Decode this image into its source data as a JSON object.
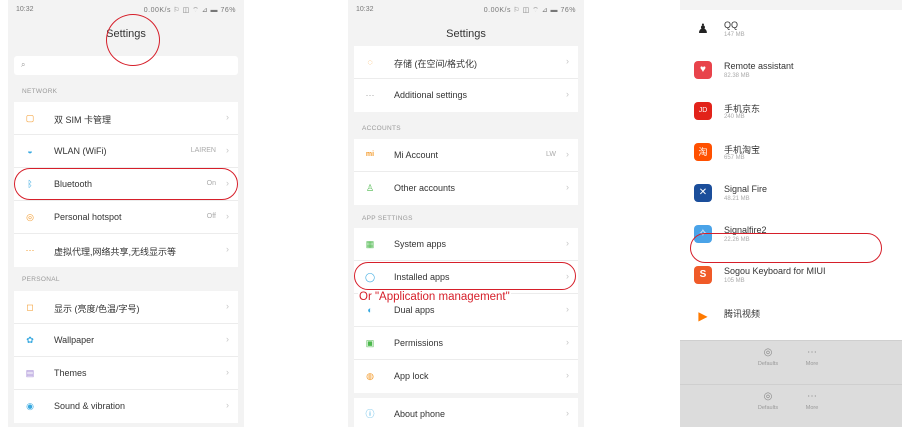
{
  "phone1": {
    "status": {
      "time": "10:32",
      "icons": "0.00K/s ⚐ ◫ ⌔ ⊿ ▬ 76%"
    },
    "title": "Settings",
    "search": {
      "placeholder": ""
    },
    "network_header": "NETWORK",
    "network_items": [
      {
        "icon": "sim-icon",
        "label": "双 SIM 卡管理",
        "value": ""
      },
      {
        "icon": "wifi-icon",
        "label": "WLAN (WiFi)",
        "value": "LAIREN"
      },
      {
        "icon": "bluetooth-icon",
        "label": "Bluetooth",
        "value": "On"
      },
      {
        "icon": "hotspot-icon",
        "label": "Personal hotspot",
        "value": "Off"
      },
      {
        "icon": "more-icon",
        "label": "虚拟代理,网络共享,无线显示等",
        "value": ""
      }
    ],
    "personal_header": "PERSONAL",
    "personal_items": [
      {
        "icon": "display-icon",
        "label": "显示 (亮度/色温/字号)",
        "value": ""
      },
      {
        "icon": "wallpaper-icon",
        "label": "Wallpaper",
        "value": ""
      },
      {
        "icon": "themes-icon",
        "label": "Themes",
        "value": ""
      },
      {
        "icon": "sound-icon",
        "label": "Sound & vibration",
        "value": ""
      }
    ]
  },
  "phone2": {
    "status": {
      "time": "10:32",
      "icons": "0.00K/s ⚐ ◫ ⌔ ⊿ ▬ 76%"
    },
    "title": "Settings",
    "top_items": [
      {
        "icon": "storage-icon",
        "label": "存储 (在空间/格式化)"
      },
      {
        "icon": "more-icon",
        "label": "Additional settings"
      }
    ],
    "accounts_header": "ACCOUNTS",
    "accounts_items": [
      {
        "icon": "mi-icon",
        "label": "Mi Account",
        "value": "LW"
      },
      {
        "icon": "person-icon",
        "label": "Other accounts",
        "value": ""
      }
    ],
    "app_settings_header": "APP SETTINGS",
    "app_items": [
      {
        "icon": "system-apps-icon",
        "label": "System apps"
      },
      {
        "icon": "installed-apps-icon",
        "label": "Installed apps"
      },
      {
        "icon": "dual-apps-icon",
        "label": "Dual apps"
      },
      {
        "icon": "permissions-icon",
        "label": "Permissions"
      },
      {
        "icon": "lock-icon",
        "label": "App lock"
      }
    ],
    "about_item": {
      "icon": "info-icon",
      "label": "About phone"
    },
    "annotation": "Or \"Application management\""
  },
  "phone3": {
    "apps": [
      {
        "name": "QQ",
        "size": "147 MB",
        "icon": "qq-icon",
        "color": "#ffffff"
      },
      {
        "name": "Remote assistant",
        "size": "82.38 MB",
        "icon": "remote-assistant-icon",
        "color": "#e8434b"
      },
      {
        "name": "手机京东",
        "size": "240 MB",
        "icon": "jd-icon",
        "color": "#e2231a"
      },
      {
        "name": "手机淘宝",
        "size": "657 MB",
        "icon": "taobao-icon",
        "color": "#ff5000"
      },
      {
        "name": "Signal Fire",
        "size": "48.21 MB",
        "icon": "signal-fire-icon",
        "color": "#1b4e9b"
      },
      {
        "name": "Signalfire2",
        "size": "22.26 MB",
        "icon": "signalfire2-icon",
        "color": "#4aa3e8"
      },
      {
        "name": "Sogou Keyboard for MIUI",
        "size": "105 MB",
        "icon": "sogou-icon",
        "color": "#f05a28"
      },
      {
        "name": "腾讯视频",
        "size": "",
        "icon": "tencent-video-icon",
        "color": "#ff7a00"
      }
    ],
    "bottom_buttons_1": [
      {
        "icon": "defaults-icon",
        "label": "Defaults"
      },
      {
        "icon": "more-icon",
        "label": "More"
      }
    ],
    "bottom_buttons_2": [
      {
        "icon": "defaults-icon",
        "label": "Defaults"
      },
      {
        "icon": "more-icon",
        "label": "More"
      }
    ]
  },
  "colors": {
    "annotation_red": "#d61f2a",
    "background": "#f3f3f3",
    "accent_orange": "#f39a2b"
  }
}
